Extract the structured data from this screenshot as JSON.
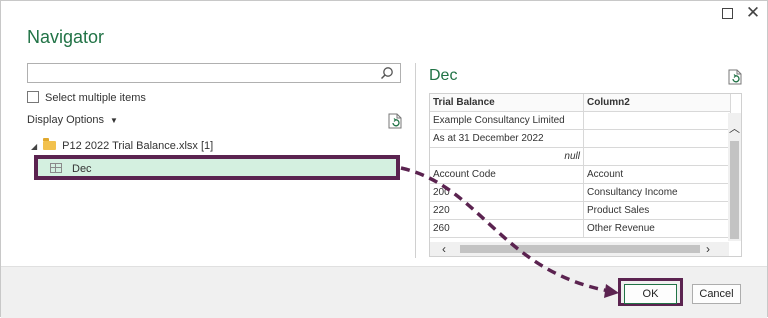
{
  "window": {
    "title": "Navigator",
    "maximize_icon": "maximize-icon",
    "close_icon": "close-icon",
    "close_glyph": "✕"
  },
  "left_panel": {
    "search": {
      "value": "",
      "placeholder": ""
    },
    "select_multiple_label": "Select multiple items",
    "select_multiple_checked": false,
    "display_options_label": "Display Options",
    "tree": {
      "file_label": "P12 2022 Trial Balance.xlsx [1]",
      "items": [
        {
          "label": "Dec",
          "selected": true
        }
      ]
    }
  },
  "preview": {
    "title": "Dec",
    "columns": [
      "Trial Balance",
      "Column2"
    ],
    "rows": [
      [
        "Example Consultancy Limited",
        ""
      ],
      [
        "As at 31 December 2022",
        ""
      ],
      [
        "null",
        ""
      ],
      [
        "Account Code",
        "Account"
      ],
      [
        "200",
        "Consultancy Income"
      ],
      [
        "220",
        "Product Sales"
      ],
      [
        "260",
        "Other Revenue"
      ]
    ]
  },
  "footer": {
    "ok_label": "OK",
    "cancel_label": "Cancel"
  },
  "colors": {
    "accent_green": "#217346",
    "highlight_border": "#5b2350",
    "selected_row_bg": "#d4f0e0"
  }
}
